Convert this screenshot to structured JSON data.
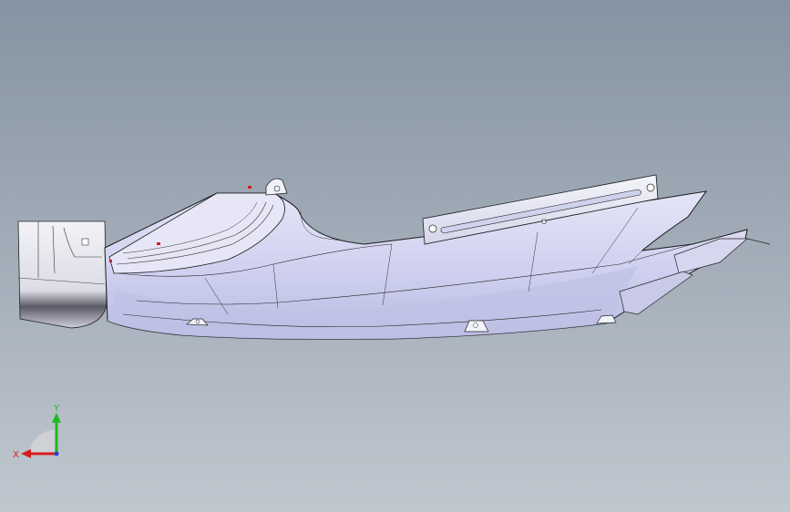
{
  "viewport": {
    "background_top": "#8593a2",
    "background_bottom": "#c0c7cf"
  },
  "model": {
    "fill_color": "#d8d8f2",
    "shade_color": "#a9aed6",
    "edge_color": "#1a1a1a",
    "highlight_color": "#cc2222"
  },
  "triad": {
    "x_label": "X",
    "y_label": "Y",
    "x_color": "#d41e1e",
    "y_color": "#1fb91f",
    "z_color": "#2244cc"
  }
}
